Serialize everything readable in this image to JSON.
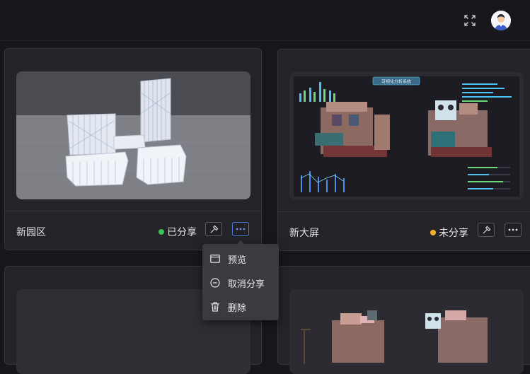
{
  "header": {
    "fullscreen_icon": "expand-icon",
    "avatar_icon": "user-avatar"
  },
  "cards": [
    {
      "title": "新园区",
      "status": "已分享",
      "status_color": "#3fbf57",
      "edit_icon": "hammer-icon",
      "more_icon": "ellipsis-icon"
    },
    {
      "title": "新大屏",
      "status": "未分享",
      "status_color": "#f2b233",
      "edit_icon": "hammer-icon",
      "more_icon": "ellipsis-icon"
    },
    {},
    {}
  ],
  "dashboard_preview": {
    "title": "可视化分析系统"
  },
  "context_menu": {
    "items": [
      {
        "label": "预览",
        "icon": "window-icon"
      },
      {
        "label": "取消分享",
        "icon": "minus-circle-icon"
      },
      {
        "label": "删除",
        "icon": "trash-icon"
      }
    ]
  },
  "colors": {
    "background": "#17171b",
    "card": "#232328",
    "accent": "#4a78d8"
  }
}
